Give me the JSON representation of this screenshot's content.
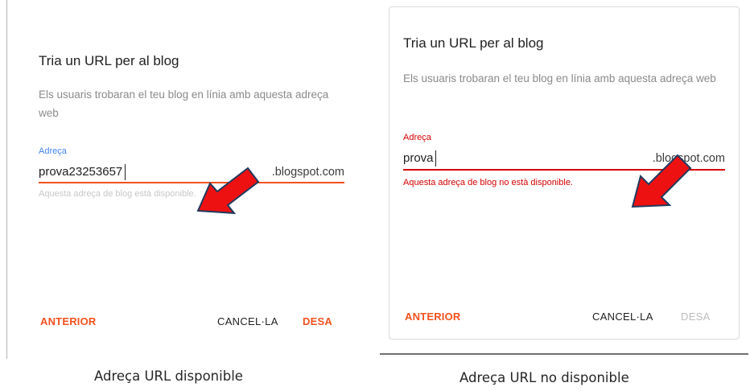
{
  "left_dialog": {
    "title": "Tria un URL per al blog",
    "description": "Els usuaris trobaran el teu blog en línia amb aquesta adreça web",
    "field_label": "Adreça",
    "field_value": "prova23253657",
    "suffix": ".blogspot.com",
    "helper_text": "Aquesta adreça de blog està disponible.",
    "buttons": {
      "back": "ANTERIOR",
      "cancel": "CANCEL·LA",
      "save": "DESA"
    }
  },
  "right_dialog": {
    "title": "Tria un URL per al blog",
    "description": "Els usuaris trobaran el teu blog en línia amb aquesta adreça web",
    "field_label": "Adreça",
    "field_value": "prova",
    "suffix": ".blogspot.com",
    "error_text": "Aquesta adreça de blog no està disponible.",
    "buttons": {
      "back": "ANTERIOR",
      "cancel": "CANCEL·LA",
      "save": "DESA"
    }
  },
  "captions": {
    "left": "Adreça URL disponible",
    "right": "Adreça URL no disponible"
  },
  "colors": {
    "accent_orange": "#f4511e",
    "focus_blue": "#4285f4",
    "error_red": "#d50000",
    "annotation_arrow": "#ee1111",
    "disabled_gray": "#bdbdbd"
  },
  "icons": [
    "arrow-pointer-annotation"
  ]
}
